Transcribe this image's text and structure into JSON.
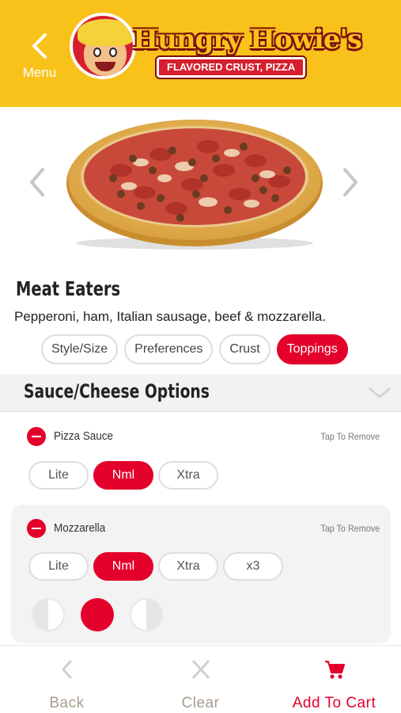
{
  "header": {
    "menu_label": "Menu",
    "brand_name": "Hungry Howie's",
    "brand_tagline": "FLAVORED CRUST, PIZZA"
  },
  "product": {
    "title": "Meat Eaters",
    "description": "Pepperoni, ham, Italian sausage, beef & mozzarella."
  },
  "tabs": [
    {
      "label": "Style/Size",
      "active": false
    },
    {
      "label": "Preferences",
      "active": false
    },
    {
      "label": "Crust",
      "active": false
    },
    {
      "label": "Toppings",
      "active": true
    }
  ],
  "section": {
    "title": "Sauce/Cheese Options"
  },
  "toppings": [
    {
      "name": "Pizza Sauce",
      "remove_hint": "Tap To Remove",
      "amounts": [
        "Lite",
        "Nml",
        "Xtra"
      ],
      "selected_amount": "Nml"
    },
    {
      "name": "Mozzarella",
      "remove_hint": "Tap To Remove",
      "amounts": [
        "Lite",
        "Nml",
        "Xtra",
        "x3"
      ],
      "selected_amount": "Nml",
      "coverage_options": [
        "left-half",
        "whole",
        "right-half"
      ],
      "selected_coverage": "whole"
    }
  ],
  "bottom_bar": {
    "back_label": "Back",
    "clear_label": "Clear",
    "cart_label": "Add To Cart"
  },
  "colors": {
    "header_yellow": "#f8c21a",
    "accent_red": "#e3002b",
    "muted_label": "#a89b8f"
  },
  "icons": {
    "menu": "chevron-left-icon",
    "prev": "chevron-left-icon",
    "next": "chevron-right-icon",
    "section_toggle": "chevron-down-icon",
    "remove": "minus-circle-icon",
    "back": "chevron-left-icon",
    "clear": "close-icon",
    "cart": "cart-icon"
  }
}
